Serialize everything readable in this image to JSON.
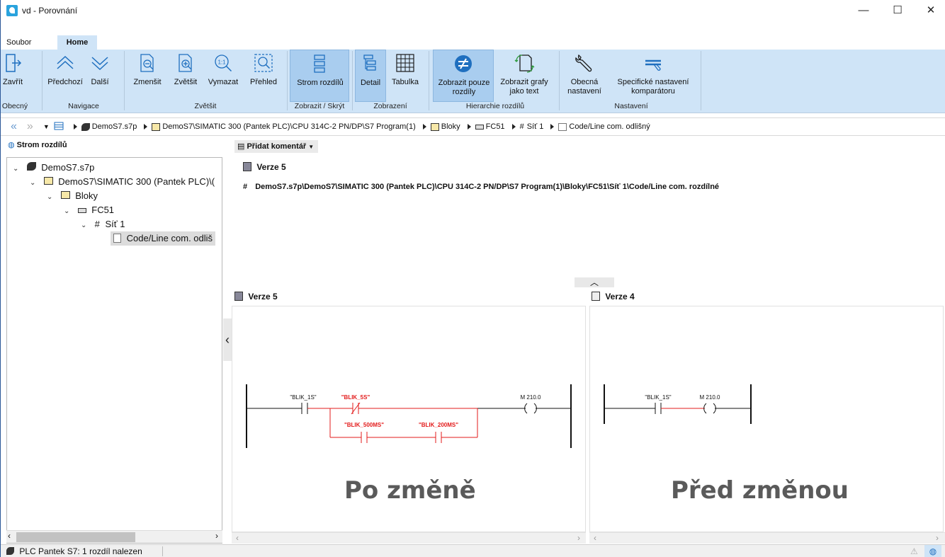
{
  "window": {
    "title": "vd - Porovnání",
    "minimize": "—",
    "maximize": "☐",
    "close": "✕"
  },
  "tabs": [
    "Soubor",
    "Home"
  ],
  "ribbon": {
    "buttons": [
      {
        "label": "Zavřít"
      },
      {
        "label": "Předchozí"
      },
      {
        "label": "Další"
      },
      {
        "label": "Zmenšit"
      },
      {
        "label": "Zvětšit"
      },
      {
        "label": "Vymazat"
      },
      {
        "label": "Přehled"
      },
      {
        "label": "Strom rozdílů"
      },
      {
        "label": "Detail"
      },
      {
        "label": "Tabulka"
      },
      {
        "label": "Zobrazit pouze rozdíly"
      },
      {
        "label": "Zobrazit grafy jako text"
      },
      {
        "label": "Obecná nastavení"
      },
      {
        "label": "Specifické nastavení komparátoru"
      }
    ],
    "groups": [
      "Obecný",
      "Navigace",
      "Zvětšit",
      "Zobrazit / Skrýt",
      "Zobrazení",
      "Hierarchie rozdílů",
      "Nastavení"
    ]
  },
  "breadcrumb": [
    "DemoS7.s7p",
    "DemoS7\\SIMATIC 300 (Pantek PLC)\\CPU 314C-2 PN/DP\\S7 Program(1)",
    "Bloky",
    "FC51",
    "Síť 1",
    "Code/Line com. odlišný"
  ],
  "tree": {
    "header": "Strom rozdílů",
    "nodes": [
      "DemoS7.s7p",
      "DemoS7\\SIMATIC 300 (Pantek PLC)\\(",
      "Bloky",
      "FC51",
      "Síť 1",
      "Code/Line com. odliš"
    ]
  },
  "detail": {
    "comment_button": "Přidat komentář",
    "version_top": "Verze 5",
    "path": "DemoS7.s7p\\DemoS7\\SIMATIC 300 (Pantek PLC)\\CPU 314C-2 PN/DP\\S7 Program(1)\\Bloky\\FC51\\Síť 1\\Code/Line com. rozdílné"
  },
  "left_pane": {
    "title": "Verze 5",
    "caption": "Po změně",
    "labels": {
      "c1": "\"BLIK_1S\"",
      "c2": "\"BLIK_5S\"",
      "c3": "\"BLIK_500MS\"",
      "c4": "\"BLIK_200MS\"",
      "coil": "M 210.0"
    }
  },
  "right_pane": {
    "title": "Verze 4",
    "caption": "Před změnou",
    "labels": {
      "c1": "\"BLIK_1S\"",
      "coil": "M 210.0"
    }
  },
  "status": {
    "text": "PLC Pantek S7: 1 rozdíl nalezen"
  },
  "colors": {
    "ribbon_bg": "#cfe4f7",
    "selected_btn": "#a9cdef",
    "diff_red": "#e31b1b"
  }
}
